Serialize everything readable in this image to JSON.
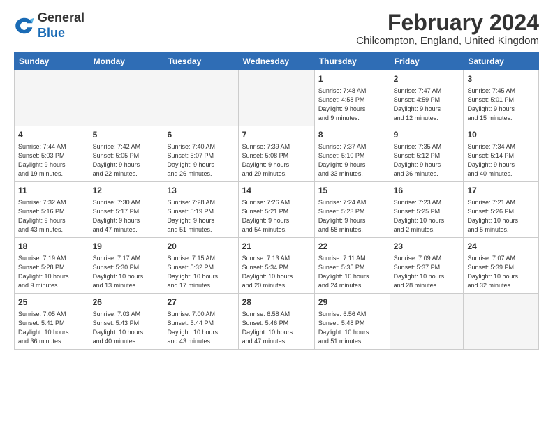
{
  "header": {
    "logo": {
      "general": "General",
      "blue": "Blue"
    },
    "title": "February 2024",
    "subtitle": "Chilcompton, England, United Kingdom"
  },
  "weekdays": [
    "Sunday",
    "Monday",
    "Tuesday",
    "Wednesday",
    "Thursday",
    "Friday",
    "Saturday"
  ],
  "weeks": [
    [
      {
        "day": "",
        "info": ""
      },
      {
        "day": "",
        "info": ""
      },
      {
        "day": "",
        "info": ""
      },
      {
        "day": "",
        "info": ""
      },
      {
        "day": "1",
        "info": "Sunrise: 7:48 AM\nSunset: 4:58 PM\nDaylight: 9 hours\nand 9 minutes."
      },
      {
        "day": "2",
        "info": "Sunrise: 7:47 AM\nSunset: 4:59 PM\nDaylight: 9 hours\nand 12 minutes."
      },
      {
        "day": "3",
        "info": "Sunrise: 7:45 AM\nSunset: 5:01 PM\nDaylight: 9 hours\nand 15 minutes."
      }
    ],
    [
      {
        "day": "4",
        "info": "Sunrise: 7:44 AM\nSunset: 5:03 PM\nDaylight: 9 hours\nand 19 minutes."
      },
      {
        "day": "5",
        "info": "Sunrise: 7:42 AM\nSunset: 5:05 PM\nDaylight: 9 hours\nand 22 minutes."
      },
      {
        "day": "6",
        "info": "Sunrise: 7:40 AM\nSunset: 5:07 PM\nDaylight: 9 hours\nand 26 minutes."
      },
      {
        "day": "7",
        "info": "Sunrise: 7:39 AM\nSunset: 5:08 PM\nDaylight: 9 hours\nand 29 minutes."
      },
      {
        "day": "8",
        "info": "Sunrise: 7:37 AM\nSunset: 5:10 PM\nDaylight: 9 hours\nand 33 minutes."
      },
      {
        "day": "9",
        "info": "Sunrise: 7:35 AM\nSunset: 5:12 PM\nDaylight: 9 hours\nand 36 minutes."
      },
      {
        "day": "10",
        "info": "Sunrise: 7:34 AM\nSunset: 5:14 PM\nDaylight: 9 hours\nand 40 minutes."
      }
    ],
    [
      {
        "day": "11",
        "info": "Sunrise: 7:32 AM\nSunset: 5:16 PM\nDaylight: 9 hours\nand 43 minutes."
      },
      {
        "day": "12",
        "info": "Sunrise: 7:30 AM\nSunset: 5:17 PM\nDaylight: 9 hours\nand 47 minutes."
      },
      {
        "day": "13",
        "info": "Sunrise: 7:28 AM\nSunset: 5:19 PM\nDaylight: 9 hours\nand 51 minutes."
      },
      {
        "day": "14",
        "info": "Sunrise: 7:26 AM\nSunset: 5:21 PM\nDaylight: 9 hours\nand 54 minutes."
      },
      {
        "day": "15",
        "info": "Sunrise: 7:24 AM\nSunset: 5:23 PM\nDaylight: 9 hours\nand 58 minutes."
      },
      {
        "day": "16",
        "info": "Sunrise: 7:23 AM\nSunset: 5:25 PM\nDaylight: 10 hours\nand 2 minutes."
      },
      {
        "day": "17",
        "info": "Sunrise: 7:21 AM\nSunset: 5:26 PM\nDaylight: 10 hours\nand 5 minutes."
      }
    ],
    [
      {
        "day": "18",
        "info": "Sunrise: 7:19 AM\nSunset: 5:28 PM\nDaylight: 10 hours\nand 9 minutes."
      },
      {
        "day": "19",
        "info": "Sunrise: 7:17 AM\nSunset: 5:30 PM\nDaylight: 10 hours\nand 13 minutes."
      },
      {
        "day": "20",
        "info": "Sunrise: 7:15 AM\nSunset: 5:32 PM\nDaylight: 10 hours\nand 17 minutes."
      },
      {
        "day": "21",
        "info": "Sunrise: 7:13 AM\nSunset: 5:34 PM\nDaylight: 10 hours\nand 20 minutes."
      },
      {
        "day": "22",
        "info": "Sunrise: 7:11 AM\nSunset: 5:35 PM\nDaylight: 10 hours\nand 24 minutes."
      },
      {
        "day": "23",
        "info": "Sunrise: 7:09 AM\nSunset: 5:37 PM\nDaylight: 10 hours\nand 28 minutes."
      },
      {
        "day": "24",
        "info": "Sunrise: 7:07 AM\nSunset: 5:39 PM\nDaylight: 10 hours\nand 32 minutes."
      }
    ],
    [
      {
        "day": "25",
        "info": "Sunrise: 7:05 AM\nSunset: 5:41 PM\nDaylight: 10 hours\nand 36 minutes."
      },
      {
        "day": "26",
        "info": "Sunrise: 7:03 AM\nSunset: 5:43 PM\nDaylight: 10 hours\nand 40 minutes."
      },
      {
        "day": "27",
        "info": "Sunrise: 7:00 AM\nSunset: 5:44 PM\nDaylight: 10 hours\nand 43 minutes."
      },
      {
        "day": "28",
        "info": "Sunrise: 6:58 AM\nSunset: 5:46 PM\nDaylight: 10 hours\nand 47 minutes."
      },
      {
        "day": "29",
        "info": "Sunrise: 6:56 AM\nSunset: 5:48 PM\nDaylight: 10 hours\nand 51 minutes."
      },
      {
        "day": "",
        "info": ""
      },
      {
        "day": "",
        "info": ""
      }
    ]
  ]
}
